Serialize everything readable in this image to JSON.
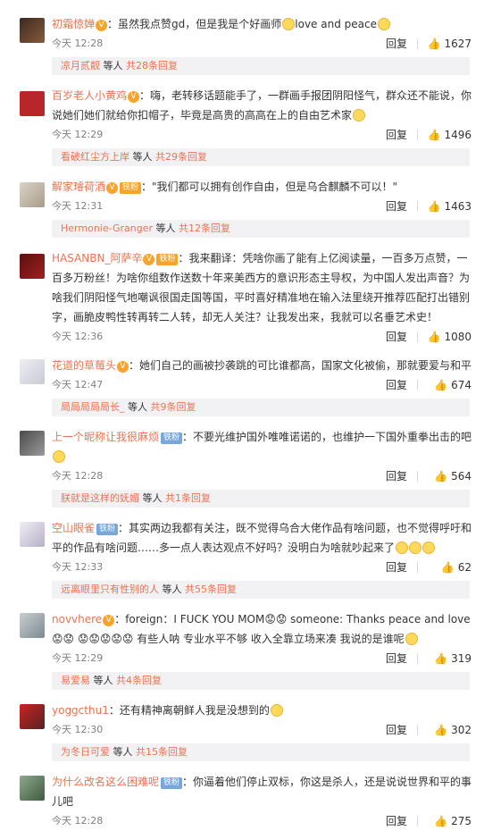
{
  "labels": {
    "reply": "回复",
    "and_others": "等人"
  },
  "comments": [
    {
      "user": "初霜惊婵",
      "badge": "",
      "vip": true,
      "text": "：虽然我点赞gd，但是我是个好画师",
      "text_after_emoji": "love and peace",
      "emoji_after": true,
      "time": "今天 12:28",
      "likes": "1627",
      "replies_by": "凉月贰靓",
      "reply_count": "共28条回复"
    },
    {
      "user": "百岁老人小黄鸡",
      "badge": "",
      "vip": true,
      "text": "：嗨，老转移话题能手了，一群画手报团阴阳怪气，群众还不能说，你说她们她们就给你扣帽子，毕竟是高贵的高高在上的自由艺术家",
      "text_after_emoji": "",
      "emoji_after": true,
      "time": "今天 12:29",
      "likes": "1496",
      "replies_by": "看破红尘方上岸",
      "reply_count": "共29条回复"
    },
    {
      "user": "解家璿荷酒",
      "badge": "铁粉",
      "vip": true,
      "text": "：\"我们都可以拥有创作自由，但是乌合麒麟不可以！\"",
      "text_after_emoji": "",
      "emoji_after": false,
      "time": "今天 12:31",
      "likes": "1463",
      "replies_by": "Hermonie-Granger",
      "reply_count": "共12条回复"
    },
    {
      "user": "HASANBN_阿萨辛",
      "badge": "铁粉",
      "vip": true,
      "text": "：我来翻译：凭啥你画了能有上亿阅读量，一百多万点赞，一百多万粉丝！为啥你组数作送数十年来美西方的意识形态主导权，为中国人发出声音？为啥我们阴阳怪气地嘲讽很国走国等国，平时喜好精准地在输入法里绕开推荐匹配打出错别字，画脆皮鸭性转再转二人转，却无人关注？让我发出来，我就可以名垂艺术史！",
      "text_after_emoji": "",
      "emoji_after": false,
      "time": "今天 12:36",
      "likes": "1080",
      "replies_by": "",
      "reply_count": ""
    },
    {
      "user": "花道的草莓头",
      "badge": "",
      "vip": true,
      "text": "：她们自己的画被抄袭跳的可比谁都高，国家文化被偷，那就要爱与和平",
      "text_after_emoji": "",
      "emoji_after": false,
      "time": "今天 12:47",
      "likes": "674",
      "replies_by": "局局局局局长_",
      "reply_count": "共9条回复"
    },
    {
      "user": "上一个昵称让我很麻烦",
      "badge": "铁粉",
      "vip": false,
      "text": "：不要光维护国外唯唯诺诺的，也维护一下国外重拳出击的吧",
      "text_after_emoji": "",
      "emoji_after": true,
      "time": "今天 12:28",
      "likes": "564",
      "replies_by": "朕就是这样的妩媚",
      "reply_count": "共1条回复"
    },
    {
      "user": "空山眼雀",
      "badge": "铁粉",
      "vip": false,
      "text": "：其实两边我都有关注，既不觉得乌合大佬作品有啥问题，也不觉得呼吁和平的作品有啥问题……多一点人表达观点不好吗？没明白为啥就吵起来了",
      "text_after_emoji": "",
      "emoji_after": true,
      "time": "今天 12:33",
      "likes": "62",
      "replies_by": "远离眼里只有性别的人",
      "reply_count": "共55条回复"
    },
    {
      "user": "novvhere",
      "badge": "",
      "vip": true,
      "text": "：foreign：I FUCK YOU MOM😟😟 someone: Thanks peace and love😟😟 😟😟😟😟😟 有些人呐  专业水平不够  收入全靠立场来凑  我说的是谁呢",
      "text_after_emoji": "",
      "emoji_after": true,
      "time": "今天 12:29",
      "likes": "319",
      "replies_by": "易爱易",
      "reply_count": "共4条回复"
    },
    {
      "user": "yoggcthu1",
      "badge": "",
      "vip": false,
      "text": "：还有精神离朝鲜人我是没想到的",
      "text_after_emoji": "",
      "emoji_after": true,
      "time": "今天 12:30",
      "likes": "302",
      "replies_by": "为冬日可爱",
      "reply_count": "共15条回复"
    },
    {
      "user": "为什么改名这么困难呢",
      "badge": "铁粉",
      "vip": false,
      "text": "：你逼着他们停止双标，你这是杀人，还是说说世界和平的事儿吧",
      "text_after_emoji": "",
      "emoji_after": false,
      "time": "今天 12:28",
      "likes": "275",
      "replies_by": "",
      "reply_count": ""
    }
  ]
}
